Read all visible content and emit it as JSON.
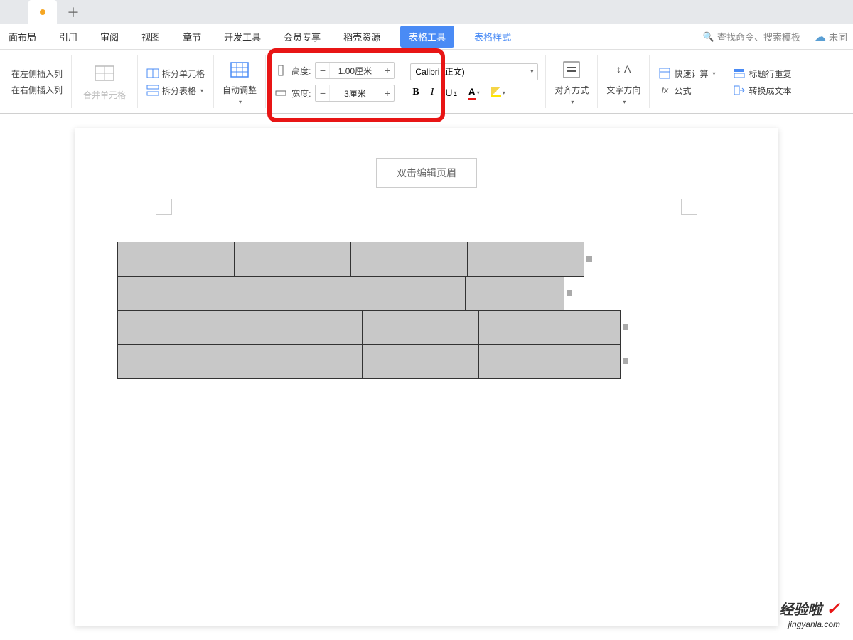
{
  "tabs": {
    "add": "＋"
  },
  "menu": {
    "items": [
      "面布局",
      "引用",
      "审阅",
      "视图",
      "章节",
      "开发工具",
      "会员专享",
      "稻壳资源"
    ],
    "active": "表格工具",
    "link": "表格样式",
    "search_placeholder": "查找命令、搜索模板",
    "cloud": "未同"
  },
  "ribbon": {
    "insert_left": "在左侧插入列",
    "insert_right": "在右侧插入列",
    "merge_cells": "合并单元格",
    "split_cells": "拆分单元格",
    "split_table": "拆分表格",
    "auto_adjust": "自动调整",
    "height_label": "高度:",
    "height_value": "1.00厘米",
    "width_label": "宽度:",
    "width_value": "3厘米",
    "font_name": "Calibri (正文)",
    "align": "对齐方式",
    "text_dir": "文字方向",
    "quick_calc": "快速计算",
    "formula": "公式",
    "header_repeat": "标题行重复",
    "to_text": "转换成文本"
  },
  "page": {
    "header_edit": "双击编辑页眉"
  },
  "watermark": {
    "main": "经验啦",
    "sub": "jingyanla.com"
  },
  "icons": {
    "minus": "−",
    "plus": "+",
    "search": "🔍",
    "cloud": "☁",
    "check": "✓",
    "bold": "B",
    "italic": "I",
    "underline": "U",
    "fx": "fx"
  }
}
